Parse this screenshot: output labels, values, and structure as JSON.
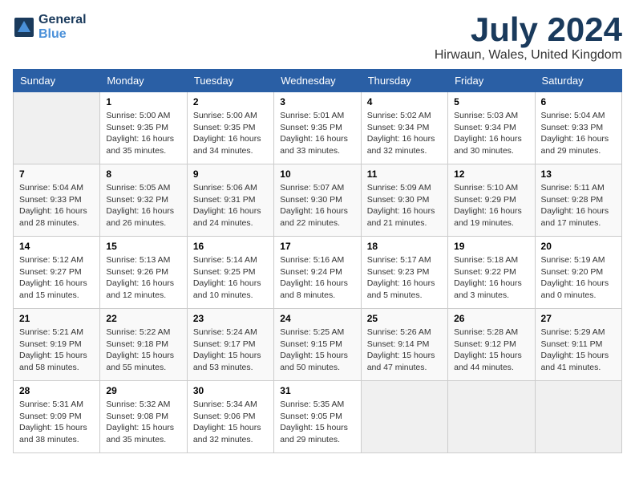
{
  "header": {
    "logo_line1": "General",
    "logo_line2": "Blue",
    "month": "July 2024",
    "location": "Hirwaun, Wales, United Kingdom"
  },
  "days_of_week": [
    "Sunday",
    "Monday",
    "Tuesday",
    "Wednesday",
    "Thursday",
    "Friday",
    "Saturday"
  ],
  "weeks": [
    [
      {
        "date": "",
        "content": ""
      },
      {
        "date": "1",
        "content": "Sunrise: 5:00 AM\nSunset: 9:35 PM\nDaylight: 16 hours\nand 35 minutes."
      },
      {
        "date": "2",
        "content": "Sunrise: 5:00 AM\nSunset: 9:35 PM\nDaylight: 16 hours\nand 34 minutes."
      },
      {
        "date": "3",
        "content": "Sunrise: 5:01 AM\nSunset: 9:35 PM\nDaylight: 16 hours\nand 33 minutes."
      },
      {
        "date": "4",
        "content": "Sunrise: 5:02 AM\nSunset: 9:34 PM\nDaylight: 16 hours\nand 32 minutes."
      },
      {
        "date": "5",
        "content": "Sunrise: 5:03 AM\nSunset: 9:34 PM\nDaylight: 16 hours\nand 30 minutes."
      },
      {
        "date": "6",
        "content": "Sunrise: 5:04 AM\nSunset: 9:33 PM\nDaylight: 16 hours\nand 29 minutes."
      }
    ],
    [
      {
        "date": "7",
        "content": "Sunrise: 5:04 AM\nSunset: 9:33 PM\nDaylight: 16 hours\nand 28 minutes."
      },
      {
        "date": "8",
        "content": "Sunrise: 5:05 AM\nSunset: 9:32 PM\nDaylight: 16 hours\nand 26 minutes."
      },
      {
        "date": "9",
        "content": "Sunrise: 5:06 AM\nSunset: 9:31 PM\nDaylight: 16 hours\nand 24 minutes."
      },
      {
        "date": "10",
        "content": "Sunrise: 5:07 AM\nSunset: 9:30 PM\nDaylight: 16 hours\nand 22 minutes."
      },
      {
        "date": "11",
        "content": "Sunrise: 5:09 AM\nSunset: 9:30 PM\nDaylight: 16 hours\nand 21 minutes."
      },
      {
        "date": "12",
        "content": "Sunrise: 5:10 AM\nSunset: 9:29 PM\nDaylight: 16 hours\nand 19 minutes."
      },
      {
        "date": "13",
        "content": "Sunrise: 5:11 AM\nSunset: 9:28 PM\nDaylight: 16 hours\nand 17 minutes."
      }
    ],
    [
      {
        "date": "14",
        "content": "Sunrise: 5:12 AM\nSunset: 9:27 PM\nDaylight: 16 hours\nand 15 minutes."
      },
      {
        "date": "15",
        "content": "Sunrise: 5:13 AM\nSunset: 9:26 PM\nDaylight: 16 hours\nand 12 minutes."
      },
      {
        "date": "16",
        "content": "Sunrise: 5:14 AM\nSunset: 9:25 PM\nDaylight: 16 hours\nand 10 minutes."
      },
      {
        "date": "17",
        "content": "Sunrise: 5:16 AM\nSunset: 9:24 PM\nDaylight: 16 hours\nand 8 minutes."
      },
      {
        "date": "18",
        "content": "Sunrise: 5:17 AM\nSunset: 9:23 PM\nDaylight: 16 hours\nand 5 minutes."
      },
      {
        "date": "19",
        "content": "Sunrise: 5:18 AM\nSunset: 9:22 PM\nDaylight: 16 hours\nand 3 minutes."
      },
      {
        "date": "20",
        "content": "Sunrise: 5:19 AM\nSunset: 9:20 PM\nDaylight: 16 hours\nand 0 minutes."
      }
    ],
    [
      {
        "date": "21",
        "content": "Sunrise: 5:21 AM\nSunset: 9:19 PM\nDaylight: 15 hours\nand 58 minutes."
      },
      {
        "date": "22",
        "content": "Sunrise: 5:22 AM\nSunset: 9:18 PM\nDaylight: 15 hours\nand 55 minutes."
      },
      {
        "date": "23",
        "content": "Sunrise: 5:24 AM\nSunset: 9:17 PM\nDaylight: 15 hours\nand 53 minutes."
      },
      {
        "date": "24",
        "content": "Sunrise: 5:25 AM\nSunset: 9:15 PM\nDaylight: 15 hours\nand 50 minutes."
      },
      {
        "date": "25",
        "content": "Sunrise: 5:26 AM\nSunset: 9:14 PM\nDaylight: 15 hours\nand 47 minutes."
      },
      {
        "date": "26",
        "content": "Sunrise: 5:28 AM\nSunset: 9:12 PM\nDaylight: 15 hours\nand 44 minutes."
      },
      {
        "date": "27",
        "content": "Sunrise: 5:29 AM\nSunset: 9:11 PM\nDaylight: 15 hours\nand 41 minutes."
      }
    ],
    [
      {
        "date": "28",
        "content": "Sunrise: 5:31 AM\nSunset: 9:09 PM\nDaylight: 15 hours\nand 38 minutes."
      },
      {
        "date": "29",
        "content": "Sunrise: 5:32 AM\nSunset: 9:08 PM\nDaylight: 15 hours\nand 35 minutes."
      },
      {
        "date": "30",
        "content": "Sunrise: 5:34 AM\nSunset: 9:06 PM\nDaylight: 15 hours\nand 32 minutes."
      },
      {
        "date": "31",
        "content": "Sunrise: 5:35 AM\nSunset: 9:05 PM\nDaylight: 15 hours\nand 29 minutes."
      },
      {
        "date": "",
        "content": ""
      },
      {
        "date": "",
        "content": ""
      },
      {
        "date": "",
        "content": ""
      }
    ]
  ]
}
